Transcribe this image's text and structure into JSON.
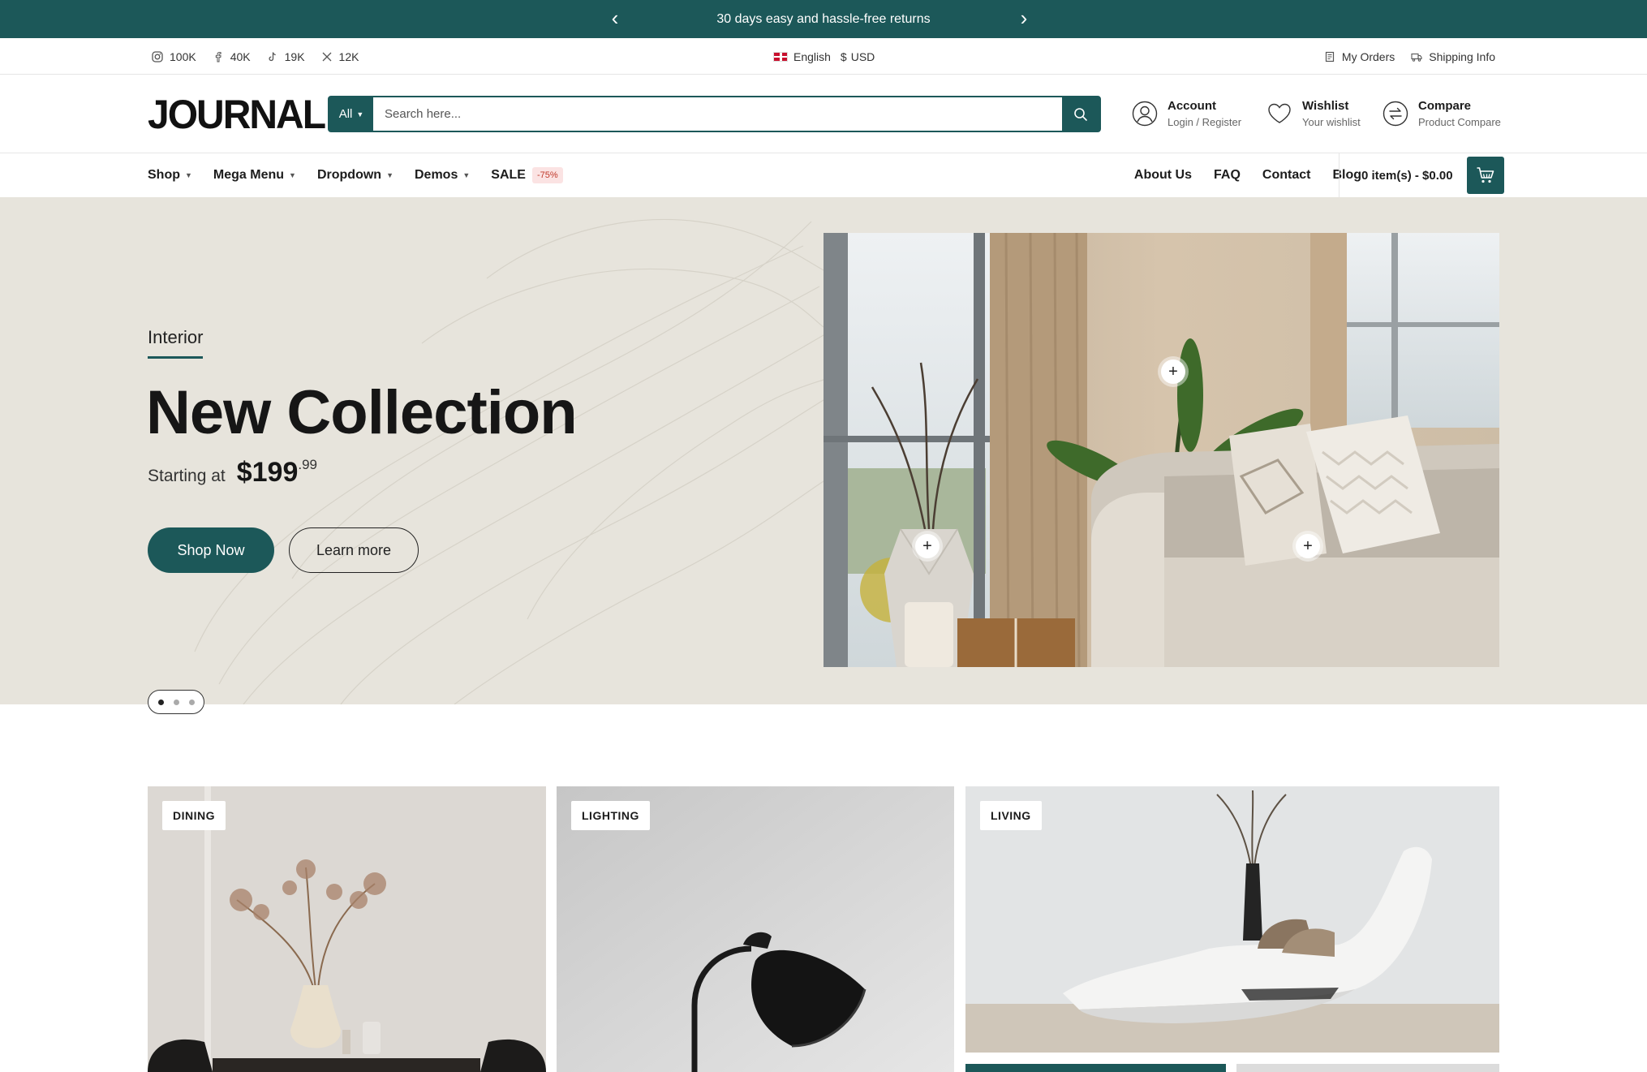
{
  "announcement": {
    "message": "30 days easy and hassle-free returns"
  },
  "social": [
    {
      "icon": "instagram-icon",
      "count": "100K"
    },
    {
      "icon": "facebook-icon",
      "count": "40K"
    },
    {
      "icon": "tiktok-icon",
      "count": "19K"
    },
    {
      "icon": "x-icon",
      "count": "12K"
    }
  ],
  "locale": {
    "language": "English",
    "currency_symbol": "$",
    "currency": "USD"
  },
  "utility_links": {
    "orders": "My Orders",
    "shipping": "Shipping Info"
  },
  "header": {
    "logo": "JOURNAL",
    "search_category": "All",
    "search_placeholder": "Search here...",
    "account_title": "Account",
    "account_sub": "Login / Register",
    "wishlist_title": "Wishlist",
    "wishlist_sub": "Your wishlist",
    "compare_title": "Compare",
    "compare_sub": "Product Compare"
  },
  "nav": {
    "left": [
      "Shop",
      "Mega Menu",
      "Dropdown",
      "Demos",
      "SALE"
    ],
    "sale_badge": "-75%",
    "right": [
      "About Us",
      "FAQ",
      "Contact",
      "Blog"
    ],
    "cart_text": "0 item(s) - $0.00"
  },
  "hero": {
    "eyebrow": "Interior",
    "title": "New Collection",
    "starting_label": "Starting at",
    "price": "$199",
    "cents": ".99",
    "primary_button": "Shop Now",
    "secondary_button": "Learn more",
    "slide_count": 3,
    "active_slide": 1
  },
  "categories": [
    {
      "label": "DINING"
    },
    {
      "label": "LIGHTING"
    },
    {
      "label": "LIVING"
    }
  ],
  "colors": {
    "brand": "#1c5859",
    "hero_bg": "#e7e4dc",
    "sale_badge_bg": "#fbe3e3",
    "sale_badge_text": "#c0392b"
  }
}
